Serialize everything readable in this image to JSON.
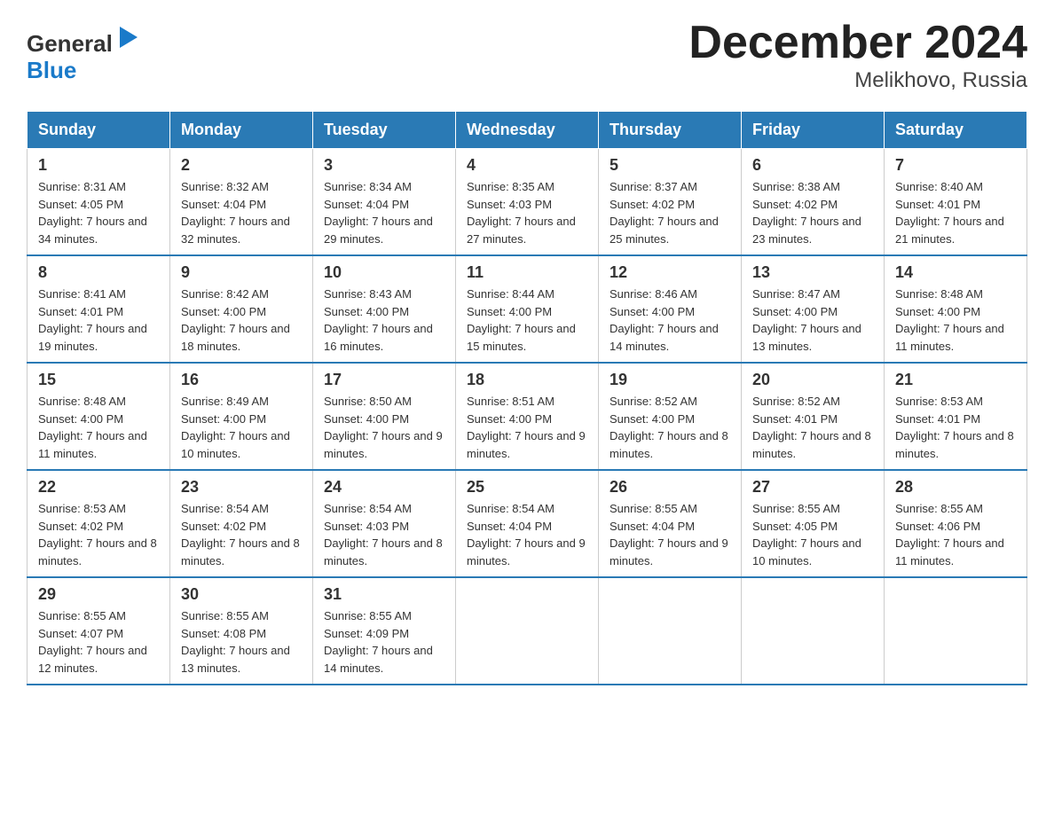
{
  "header": {
    "logo_line1": "General",
    "logo_line2": "Blue",
    "title": "December 2024",
    "subtitle": "Melikhovo, Russia"
  },
  "calendar": {
    "columns": [
      "Sunday",
      "Monday",
      "Tuesday",
      "Wednesday",
      "Thursday",
      "Friday",
      "Saturday"
    ],
    "rows": [
      [
        {
          "date": "1",
          "sunrise": "Sunrise: 8:31 AM",
          "sunset": "Sunset: 4:05 PM",
          "daylight": "Daylight: 7 hours and 34 minutes."
        },
        {
          "date": "2",
          "sunrise": "Sunrise: 8:32 AM",
          "sunset": "Sunset: 4:04 PM",
          "daylight": "Daylight: 7 hours and 32 minutes."
        },
        {
          "date": "3",
          "sunrise": "Sunrise: 8:34 AM",
          "sunset": "Sunset: 4:04 PM",
          "daylight": "Daylight: 7 hours and 29 minutes."
        },
        {
          "date": "4",
          "sunrise": "Sunrise: 8:35 AM",
          "sunset": "Sunset: 4:03 PM",
          "daylight": "Daylight: 7 hours and 27 minutes."
        },
        {
          "date": "5",
          "sunrise": "Sunrise: 8:37 AM",
          "sunset": "Sunset: 4:02 PM",
          "daylight": "Daylight: 7 hours and 25 minutes."
        },
        {
          "date": "6",
          "sunrise": "Sunrise: 8:38 AM",
          "sunset": "Sunset: 4:02 PM",
          "daylight": "Daylight: 7 hours and 23 minutes."
        },
        {
          "date": "7",
          "sunrise": "Sunrise: 8:40 AM",
          "sunset": "Sunset: 4:01 PM",
          "daylight": "Daylight: 7 hours and 21 minutes."
        }
      ],
      [
        {
          "date": "8",
          "sunrise": "Sunrise: 8:41 AM",
          "sunset": "Sunset: 4:01 PM",
          "daylight": "Daylight: 7 hours and 19 minutes."
        },
        {
          "date": "9",
          "sunrise": "Sunrise: 8:42 AM",
          "sunset": "Sunset: 4:00 PM",
          "daylight": "Daylight: 7 hours and 18 minutes."
        },
        {
          "date": "10",
          "sunrise": "Sunrise: 8:43 AM",
          "sunset": "Sunset: 4:00 PM",
          "daylight": "Daylight: 7 hours and 16 minutes."
        },
        {
          "date": "11",
          "sunrise": "Sunrise: 8:44 AM",
          "sunset": "Sunset: 4:00 PM",
          "daylight": "Daylight: 7 hours and 15 minutes."
        },
        {
          "date": "12",
          "sunrise": "Sunrise: 8:46 AM",
          "sunset": "Sunset: 4:00 PM",
          "daylight": "Daylight: 7 hours and 14 minutes."
        },
        {
          "date": "13",
          "sunrise": "Sunrise: 8:47 AM",
          "sunset": "Sunset: 4:00 PM",
          "daylight": "Daylight: 7 hours and 13 minutes."
        },
        {
          "date": "14",
          "sunrise": "Sunrise: 8:48 AM",
          "sunset": "Sunset: 4:00 PM",
          "daylight": "Daylight: 7 hours and 11 minutes."
        }
      ],
      [
        {
          "date": "15",
          "sunrise": "Sunrise: 8:48 AM",
          "sunset": "Sunset: 4:00 PM",
          "daylight": "Daylight: 7 hours and 11 minutes."
        },
        {
          "date": "16",
          "sunrise": "Sunrise: 8:49 AM",
          "sunset": "Sunset: 4:00 PM",
          "daylight": "Daylight: 7 hours and 10 minutes."
        },
        {
          "date": "17",
          "sunrise": "Sunrise: 8:50 AM",
          "sunset": "Sunset: 4:00 PM",
          "daylight": "Daylight: 7 hours and 9 minutes."
        },
        {
          "date": "18",
          "sunrise": "Sunrise: 8:51 AM",
          "sunset": "Sunset: 4:00 PM",
          "daylight": "Daylight: 7 hours and 9 minutes."
        },
        {
          "date": "19",
          "sunrise": "Sunrise: 8:52 AM",
          "sunset": "Sunset: 4:00 PM",
          "daylight": "Daylight: 7 hours and 8 minutes."
        },
        {
          "date": "20",
          "sunrise": "Sunrise: 8:52 AM",
          "sunset": "Sunset: 4:01 PM",
          "daylight": "Daylight: 7 hours and 8 minutes."
        },
        {
          "date": "21",
          "sunrise": "Sunrise: 8:53 AM",
          "sunset": "Sunset: 4:01 PM",
          "daylight": "Daylight: 7 hours and 8 minutes."
        }
      ],
      [
        {
          "date": "22",
          "sunrise": "Sunrise: 8:53 AM",
          "sunset": "Sunset: 4:02 PM",
          "daylight": "Daylight: 7 hours and 8 minutes."
        },
        {
          "date": "23",
          "sunrise": "Sunrise: 8:54 AM",
          "sunset": "Sunset: 4:02 PM",
          "daylight": "Daylight: 7 hours and 8 minutes."
        },
        {
          "date": "24",
          "sunrise": "Sunrise: 8:54 AM",
          "sunset": "Sunset: 4:03 PM",
          "daylight": "Daylight: 7 hours and 8 minutes."
        },
        {
          "date": "25",
          "sunrise": "Sunrise: 8:54 AM",
          "sunset": "Sunset: 4:04 PM",
          "daylight": "Daylight: 7 hours and 9 minutes."
        },
        {
          "date": "26",
          "sunrise": "Sunrise: 8:55 AM",
          "sunset": "Sunset: 4:04 PM",
          "daylight": "Daylight: 7 hours and 9 minutes."
        },
        {
          "date": "27",
          "sunrise": "Sunrise: 8:55 AM",
          "sunset": "Sunset: 4:05 PM",
          "daylight": "Daylight: 7 hours and 10 minutes."
        },
        {
          "date": "28",
          "sunrise": "Sunrise: 8:55 AM",
          "sunset": "Sunset: 4:06 PM",
          "daylight": "Daylight: 7 hours and 11 minutes."
        }
      ],
      [
        {
          "date": "29",
          "sunrise": "Sunrise: 8:55 AM",
          "sunset": "Sunset: 4:07 PM",
          "daylight": "Daylight: 7 hours and 12 minutes."
        },
        {
          "date": "30",
          "sunrise": "Sunrise: 8:55 AM",
          "sunset": "Sunset: 4:08 PM",
          "daylight": "Daylight: 7 hours and 13 minutes."
        },
        {
          "date": "31",
          "sunrise": "Sunrise: 8:55 AM",
          "sunset": "Sunset: 4:09 PM",
          "daylight": "Daylight: 7 hours and 14 minutes."
        },
        null,
        null,
        null,
        null
      ]
    ]
  }
}
